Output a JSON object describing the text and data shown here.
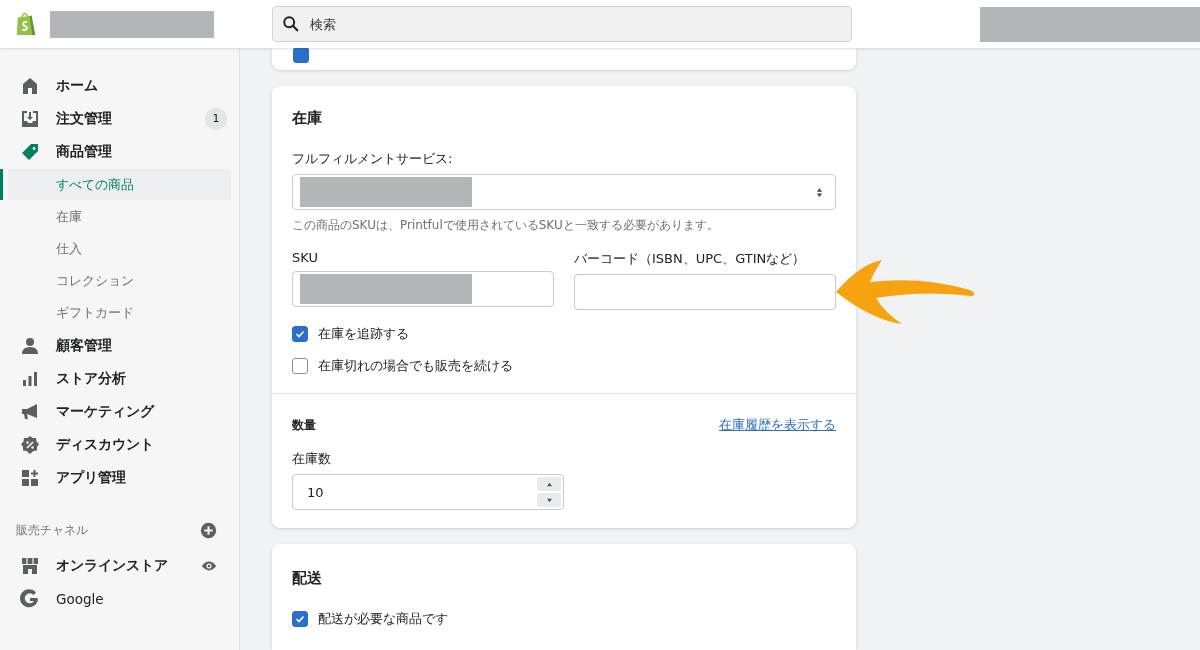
{
  "header": {
    "search": {
      "placeholder": "検索"
    }
  },
  "sidebar": {
    "items": [
      {
        "label": "ホーム",
        "kind": "home",
        "selected": false
      },
      {
        "label": "注文管理",
        "kind": "orders",
        "badge": "1",
        "selected": false
      },
      {
        "label": "商品管理",
        "kind": "tag",
        "selected": true,
        "children": [
          {
            "label": "すべての商品",
            "selected": true
          },
          {
            "label": "在庫",
            "selected": false
          },
          {
            "label": "仕入",
            "selected": false
          },
          {
            "label": "コレクション",
            "selected": false
          },
          {
            "label": "ギフトカード",
            "selected": false
          }
        ]
      },
      {
        "label": "顧客管理",
        "kind": "person",
        "selected": false
      },
      {
        "label": "ストア分析",
        "kind": "bars",
        "selected": false
      },
      {
        "label": "マーケティング",
        "kind": "megaphone",
        "selected": false
      },
      {
        "label": "ディスカウント",
        "kind": "discount",
        "selected": false
      },
      {
        "label": "アプリ管理",
        "kind": "apps",
        "selected": false
      }
    ],
    "channels": {
      "title": "販売チャネル",
      "items": [
        {
          "label": "オンラインストア",
          "kind": "store"
        },
        {
          "label": "Google",
          "kind": "google"
        }
      ]
    }
  },
  "top_card": {
    "checkbox": {
      "checked": true
    }
  },
  "inventory": {
    "title": "在庫",
    "fulfillment_label": "フルフィルメントサービス:",
    "fulfillment_help": "この商品のSKUは、Printfulで使用されているSKUと一致する必要があります。",
    "sku_label": "SKU",
    "barcode_label": "バーコード（ISBN、UPC、GTINなど）",
    "checkboxes": [
      {
        "label": "在庫を追跡する",
        "checked": true
      },
      {
        "label": "在庫切れの場合でも販売を続ける",
        "checked": false
      }
    ],
    "quantity_title": "数量",
    "history_link": "在庫履歴を表示する",
    "stock_label": "在庫数",
    "stock_value": "10"
  },
  "shipping": {
    "title": "配送",
    "checkbox": {
      "label": "配送が必要な商品です",
      "checked": true
    }
  }
}
